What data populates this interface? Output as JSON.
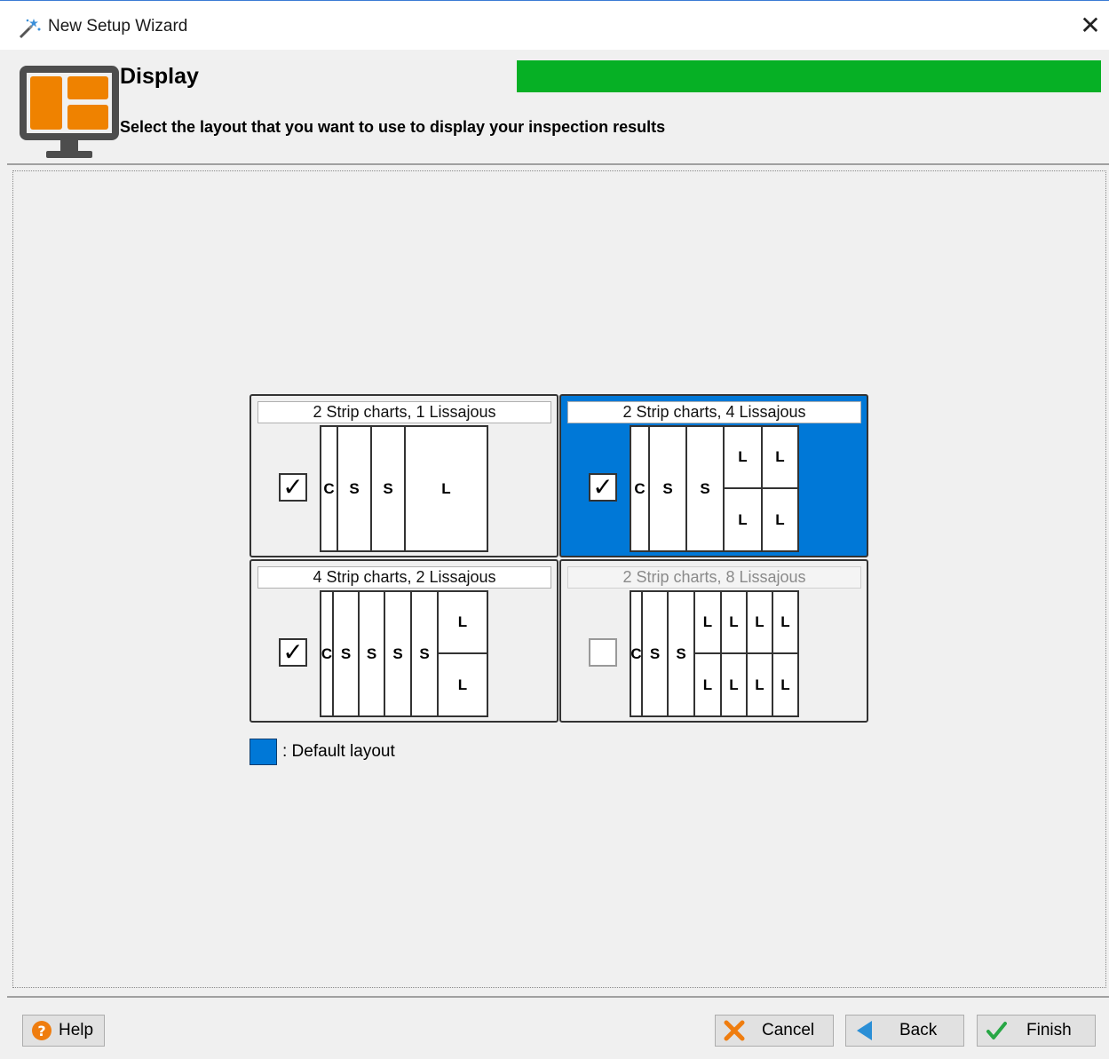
{
  "window": {
    "title": "New Setup Wizard",
    "close_glyph": "✕"
  },
  "header": {
    "title": "Display",
    "subtitle": "Select the layout that you want to use to display your inspection results",
    "progress": 1.0,
    "progress_color": "#06b025",
    "icon": "monitor-layout-icon"
  },
  "layouts": [
    {
      "label": "2 Strip charts, 1 Lissajous",
      "checked": true,
      "default": false,
      "enabled": true
    },
    {
      "label": "2 Strip charts, 4 Lissajous",
      "checked": true,
      "default": true,
      "enabled": true
    },
    {
      "label": "4 Strip charts, 2 Lissajous",
      "checked": true,
      "default": false,
      "enabled": true
    },
    {
      "label": "2 Strip charts, 8 Lissajous",
      "checked": false,
      "default": false,
      "enabled": false
    }
  ],
  "pane_letters": {
    "c": "C",
    "s": "S",
    "l": "L"
  },
  "legend": {
    "text": ": Default layout",
    "color": "#0078d7"
  },
  "buttons": {
    "help": "Help",
    "cancel": "Cancel",
    "back": "Back",
    "finish": "Finish"
  },
  "checkmark": "✓"
}
